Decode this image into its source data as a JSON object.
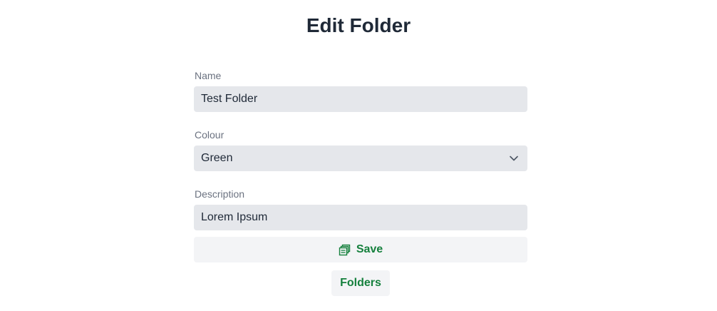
{
  "page": {
    "title": "Edit Folder"
  },
  "form": {
    "name_label": "Name",
    "name_value": "Test Folder",
    "colour_label": "Colour",
    "colour_value": "Green",
    "description_label": "Description",
    "description_value": "Lorem Ipsum",
    "save_label": "Save"
  },
  "nav": {
    "folders_label": "Folders"
  },
  "icons": {
    "save": "save-stack-icon",
    "dropdown": "chevron-down-icon"
  },
  "colors": {
    "accent": "#15803d",
    "field_bg": "#e5e7eb",
    "button_bg": "#f3f4f6"
  }
}
